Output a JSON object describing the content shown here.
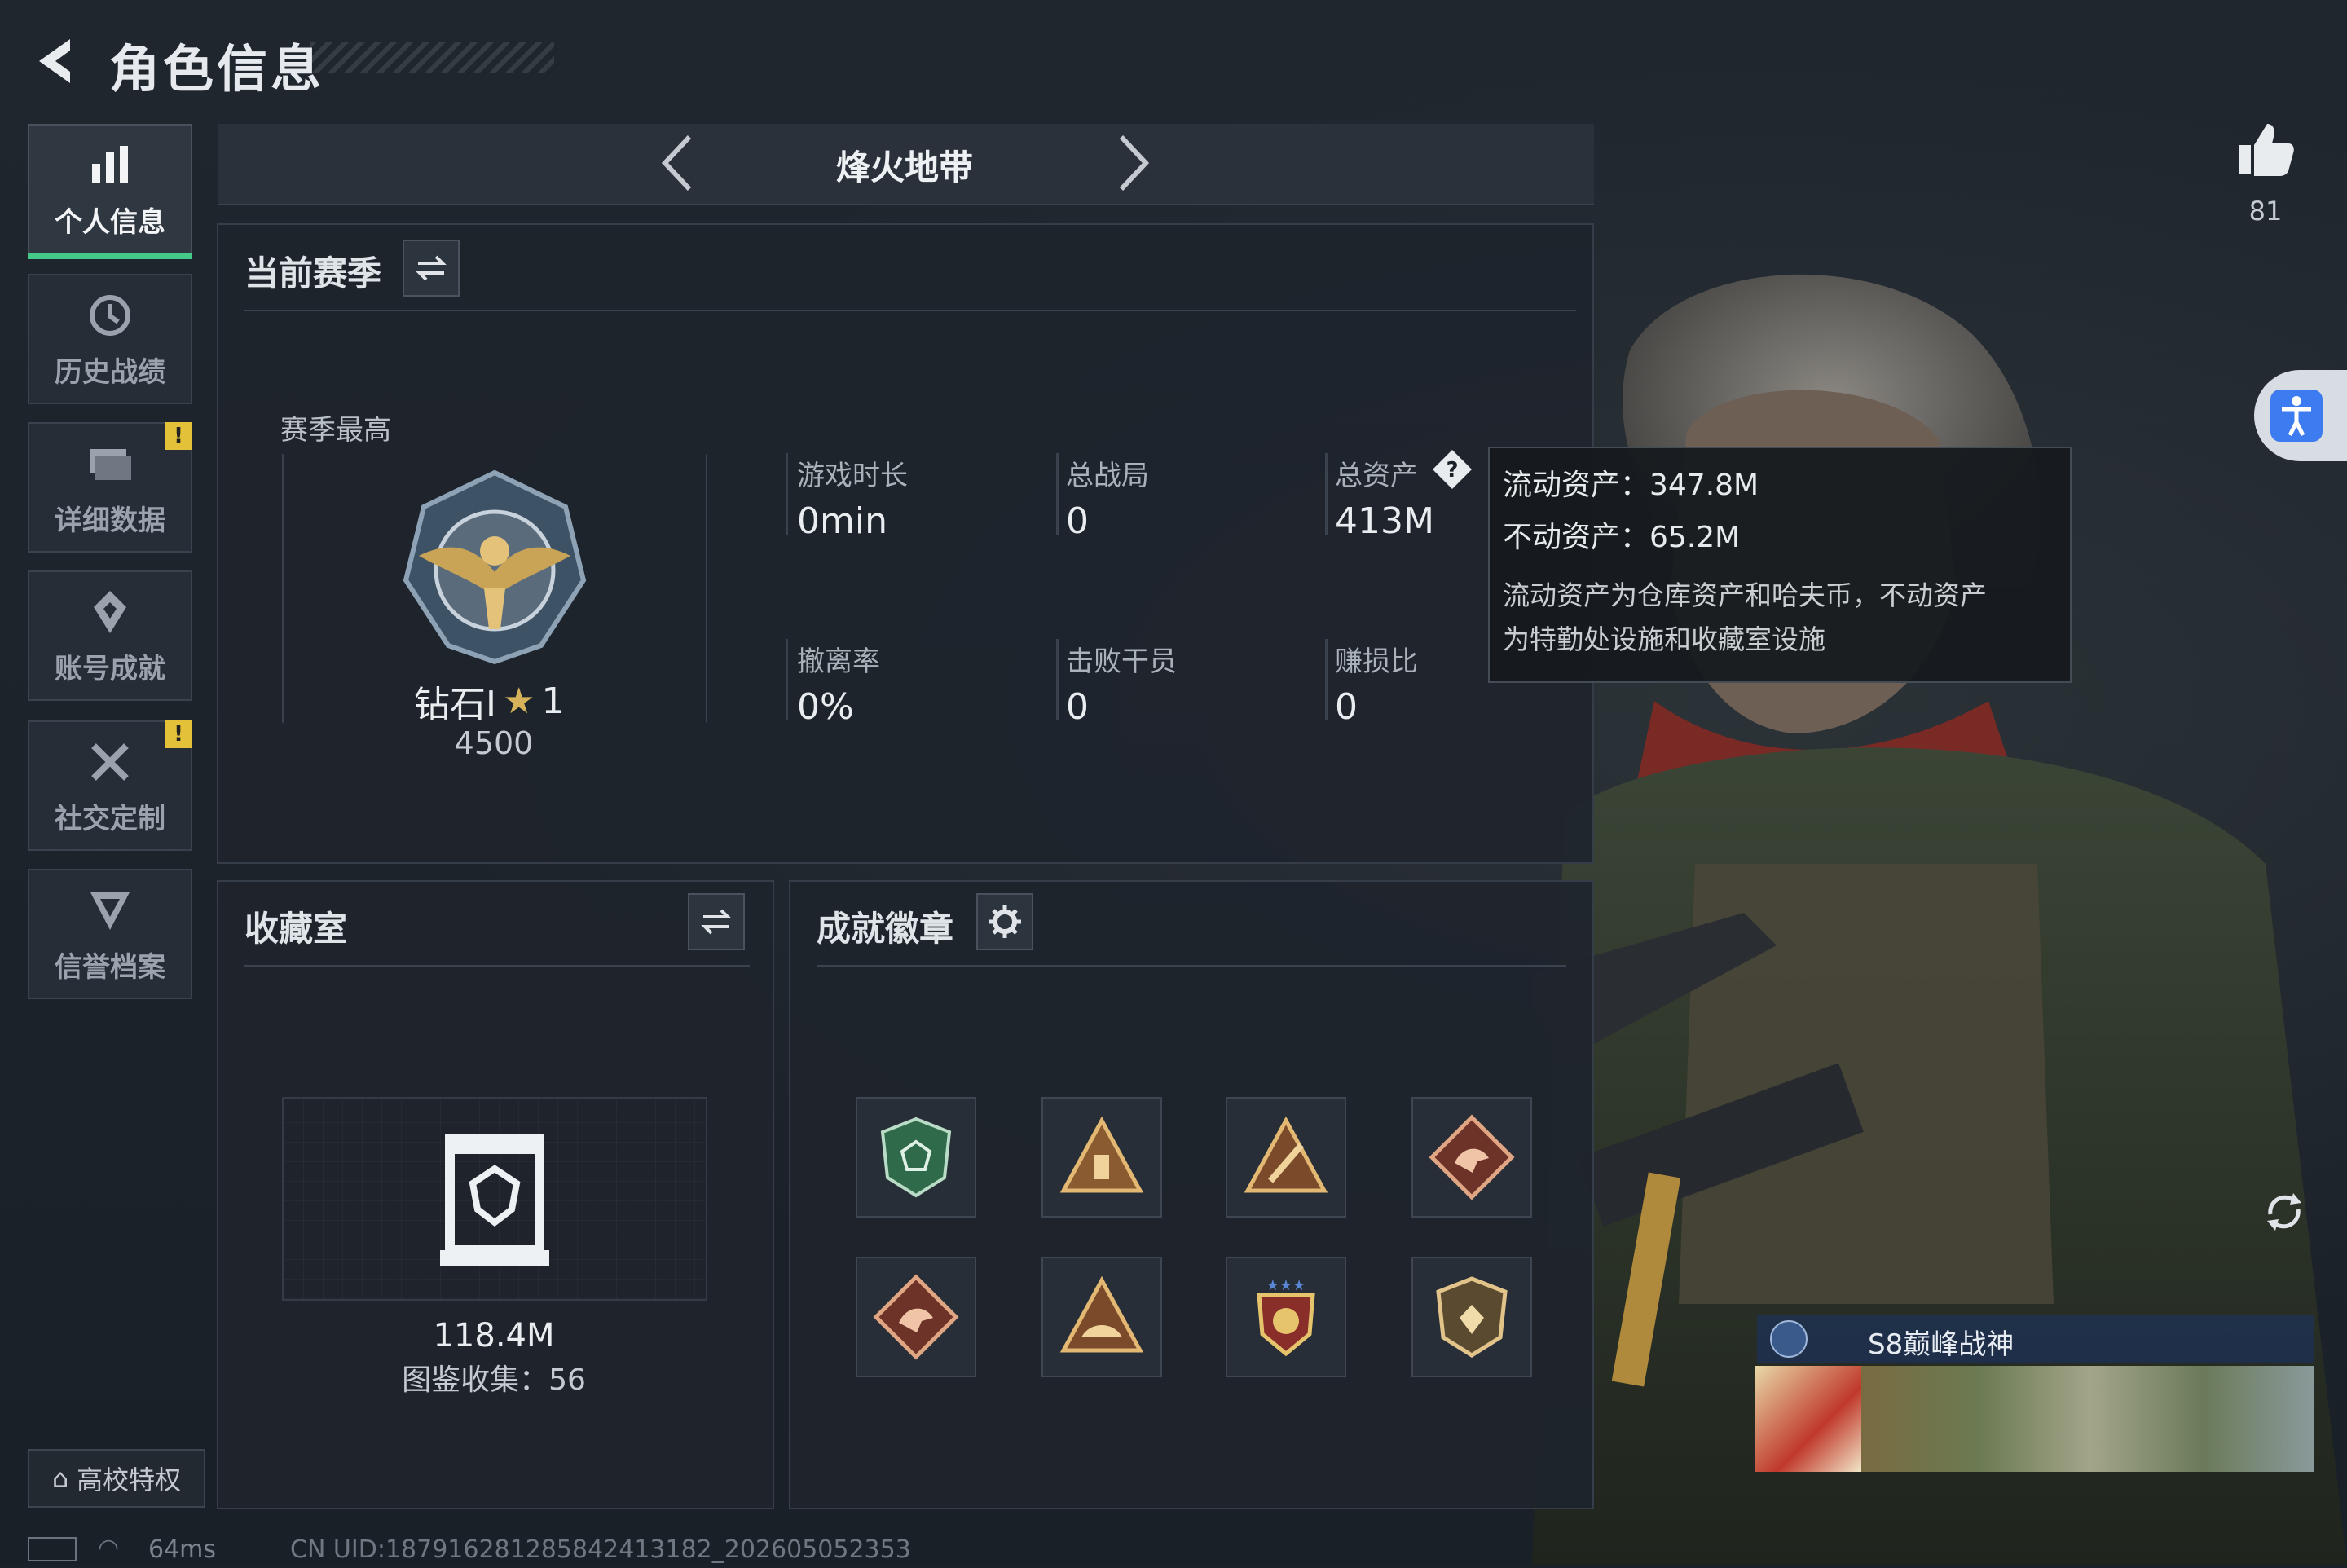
{
  "header": {
    "title": "角色信息"
  },
  "sidebar": {
    "items": [
      {
        "label": "个人信息",
        "icon": "bar-chart-icon",
        "active": true,
        "warn": ""
      },
      {
        "label": "历史战绩",
        "icon": "history-icon",
        "active": false,
        "warn": ""
      },
      {
        "label": "详细数据",
        "icon": "folder-icon",
        "active": false,
        "warn": "!"
      },
      {
        "label": "账号成就",
        "icon": "achievement-icon",
        "active": false,
        "warn": ""
      },
      {
        "label": "社交定制",
        "icon": "tools-icon",
        "active": false,
        "warn": "!"
      },
      {
        "label": "信誉档案",
        "icon": "credit-icon",
        "active": false,
        "warn": ""
      }
    ],
    "privilege_label": "高校特权"
  },
  "mode": {
    "title": "烽火地带"
  },
  "season": {
    "title": "当前赛季",
    "best_label": "赛季最高",
    "rank_name": "钻石I",
    "rank_stars": "1",
    "rank_score": "4500",
    "stats": [
      {
        "label": "游戏时长",
        "value": "0min"
      },
      {
        "label": "总战局",
        "value": "0"
      },
      {
        "label": "总资产",
        "value": "413M"
      },
      {
        "label": "撤离率",
        "value": "0%"
      },
      {
        "label": "击败干员",
        "value": "0"
      },
      {
        "label": "赚损比",
        "value": "0"
      }
    ]
  },
  "tooltip": {
    "liquid": "流动资产：347.8M",
    "fixed": "不动资产：65.2M",
    "desc1": "流动资产为仓库资产和哈夫币，不动资产",
    "desc2": "为特勤处设施和收藏室设施"
  },
  "collection": {
    "title": "收藏室",
    "value": "118.4M",
    "count": "图鉴收集：56"
  },
  "badges": {
    "title": "成就徽章"
  },
  "likes": {
    "count": "81"
  },
  "player_card": {
    "title": "S8巅峰战神"
  },
  "status": {
    "ping": "64ms",
    "uid": "CN UID:18791628128584241318​2_202605052353"
  },
  "colors": {
    "accent": "#45c98a",
    "warn": "#e3c23a",
    "bg": "#1b2129",
    "accessibility": "#3d7bf0"
  }
}
